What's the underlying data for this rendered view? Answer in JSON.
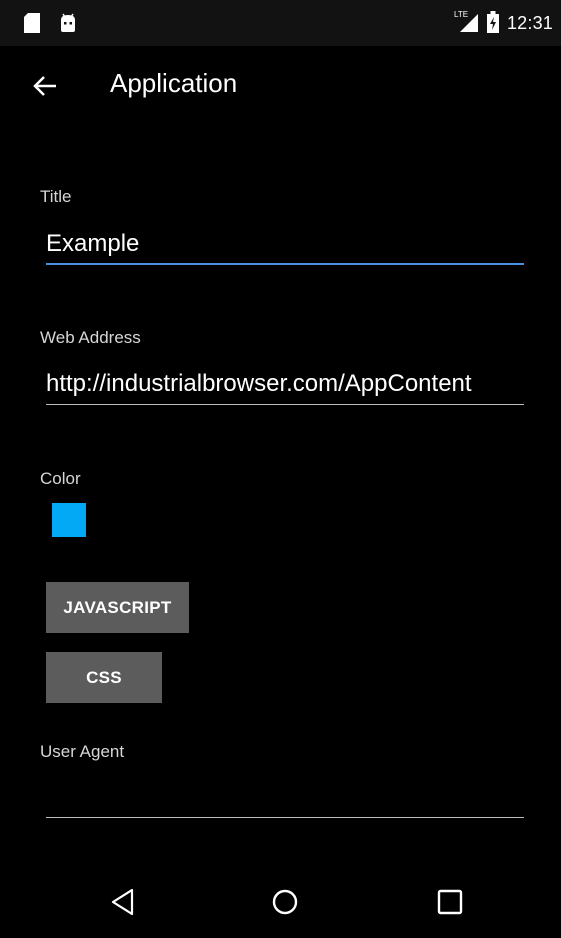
{
  "status_bar": {
    "time": "12:31",
    "network_label": "LTE",
    "icons": [
      "sd-card-icon",
      "android-icon",
      "signal-icon",
      "battery-icon"
    ]
  },
  "toolbar": {
    "title": "Application",
    "back_icon": "arrow-left-icon"
  },
  "form": {
    "title_label": "Title",
    "title_value": "Example",
    "web_address_label": "Web Address",
    "web_address_value": "http://industrialbrowser.com/AppContent",
    "color_label": "Color",
    "color_value": "#03a9f4",
    "javascript_button": "JAVASCRIPT",
    "css_button": "CSS",
    "user_agent_label": "User Agent",
    "user_agent_value": ""
  },
  "nav_bar": {
    "icons": [
      "back-triangle-icon",
      "home-circle-icon",
      "recents-square-icon"
    ]
  },
  "colors": {
    "focus_underline": "#4a90e2",
    "button_bg": "#5c5c5c",
    "swatch": "#03a9f4"
  }
}
